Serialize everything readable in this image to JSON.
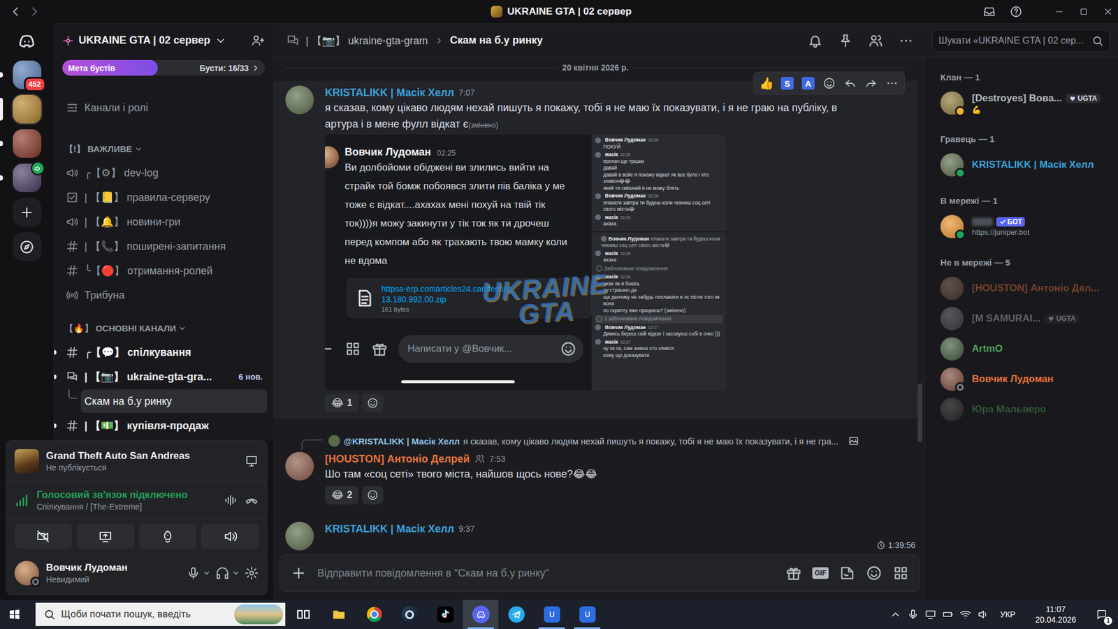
{
  "window": {
    "title": "UKRAINE GTA | 02 сервер"
  },
  "servers": [
    {
      "kind": "home",
      "selected": false,
      "unread": false
    },
    {
      "kind": "server",
      "color": "#5a7fb8",
      "badge": "452",
      "selected": false,
      "unread": true,
      "voice": false
    },
    {
      "kind": "server",
      "color": "#b8862e",
      "selected": true,
      "unread": false,
      "voice": false
    },
    {
      "kind": "server",
      "color": "#8b3a2a",
      "selected": false,
      "unread": true,
      "voice": false
    },
    {
      "kind": "server",
      "color": "#4b3d66",
      "selected": false,
      "unread": true,
      "voice": true
    },
    {
      "kind": "add",
      "selected": false,
      "unread": false
    },
    {
      "kind": "discover",
      "selected": false,
      "unread": false
    }
  ],
  "server": {
    "name": "UKRAINE GTA | 02 сервер",
    "boost_label": "Мета бустів",
    "boost_count": "Бусти: 16/33",
    "boost_level": 0.47
  },
  "channels": [
    {
      "kind": "link",
      "name": "Канали і ролі",
      "unread": false,
      "selected": false
    },
    {
      "kind": "category",
      "name": "【!】 ВАЖЛИВЕ",
      "expanded": true
    },
    {
      "kind": "announcement",
      "name": "╭【⚙】 dev-log",
      "unread": false,
      "selected": false
    },
    {
      "kind": "rules",
      "name": "| 【📒】 правила-серверу",
      "unread": false,
      "selected": false
    },
    {
      "kind": "announcement",
      "name": "| 【🔔】 новини-гри",
      "unread": false,
      "selected": false
    },
    {
      "kind": "text",
      "name": "| 【📞】 поширені-запитання",
      "unread": false,
      "selected": false
    },
    {
      "kind": "text",
      "name": "╰【🔴】 отримання-ролей",
      "unread": false,
      "selected": false
    },
    {
      "kind": "stage",
      "name": "Трибуна",
      "unread": false,
      "selected": false
    },
    {
      "kind": "category",
      "name": "【🔥】 ОСНОВНІ КАНАЛИ",
      "expanded": true
    },
    {
      "kind": "text",
      "name": "╭【💬】 спілкування",
      "unread": true,
      "selected": false
    },
    {
      "kind": "forum",
      "name": "| 【📷】 ukraine-gta-gra...",
      "unread": true,
      "selected": false,
      "badge": "6 нов."
    },
    {
      "kind": "thread",
      "name": "Скам на б.у ринку",
      "unread": false,
      "selected": true
    },
    {
      "kind": "text",
      "name": "| 【💵】 купівля-продаж",
      "unread": true,
      "selected": false
    }
  ],
  "activity": {
    "game": "Grand Theft Auto San Andreas",
    "status": "Не публікується"
  },
  "voice": {
    "status": "Голосовий зв'язок підключено",
    "channel": "Спілкування / [The-Extreme]",
    "camera_on": false
  },
  "user": {
    "name": "Вовчик Лудоман",
    "status": "Невидимий",
    "presence": "invisible"
  },
  "header": {
    "forum": "| 【📷】 ukraine-gta-gram",
    "thread": "Скам на б.у ринку",
    "search_placeholder": "Шукати «UKRAINE GTA | 02 сер..."
  },
  "date_divider": "20 квітня 2026 р.",
  "hover_toolbar": [
    {
      "kind": "emoji",
      "label": "👍"
    },
    {
      "kind": "app",
      "label": "S"
    },
    {
      "kind": "app",
      "label": "A"
    },
    {
      "kind": "add-reaction"
    },
    {
      "kind": "reply"
    },
    {
      "kind": "forward"
    },
    {
      "kind": "more"
    }
  ],
  "messages": [
    {
      "author": "KRISTALIKK | Масік Хелл",
      "color": "#3ba2dc",
      "avatar": "#5b6b4a",
      "role_icon": false,
      "time": "7:07",
      "hovered": true,
      "text": "я сказав, кому цікаво людям нехай пишуть я покажу, тобі я не маю їх показувати, і я не граю на публіку, в артура і в мене фулл відкат є",
      "edited": "(змінено)",
      "embed": {
        "author": "Вовчик Лудоман",
        "time": "02:25",
        "lines": [
          "Ви долбойоми обіджені ви злились вийти на",
          "страйк той бомж побоявся злити пів баліка у ме",
          "тоже є відкат....ахахах мені похуй на твій тік",
          "ток))))я можу закинути у тік ток як ти дрочеш",
          "перед компом або як трахають твою мамку коли",
          "не вдома"
        ],
        "file": {
          "name": [
            "httpsa-erp.comarticles24.camfecting",
            "13.180.992.00.zip"
          ],
          "size": "161 bytes"
        },
        "input_placeholder": "Написати у @Вовчик...",
        "watermark": [
          "UKRAINE",
          "GTA"
        ],
        "chat": [
          {
            "kind": "message",
            "author": "Вовчик Лудоман",
            "time": "02:25",
            "lines": [
              "ПОХУЙ"
            ]
          },
          {
            "kind": "message",
            "author": "масік",
            "time": "02:25",
            "lines": [
              "поплач ще трішки",
              "давай",
              "давай в войс я покажу відкат як все було і хто злився😂😂",
              "який ти смішний я не можу блять"
            ]
          },
          {
            "kind": "message",
            "author": "Вовчик Лудоман",
            "time": "02:26",
            "lines": [
              "плакати завтра ти будеш коли чекниш соц сеті свого міста😂"
            ]
          },
          {
            "kind": "message",
            "author": "масік",
            "time": "02:26",
            "lines": [
              "ахаха"
            ]
          },
          {
            "kind": "break"
          },
          {
            "kind": "reply",
            "author": "Вовчик Лудоман",
            "text": "плакати завтра ти будеш коли чекниш соц сеті свого міста😂"
          },
          {
            "kind": "message",
            "author": "масік",
            "time": "02:26",
            "lines": [
              "ахаха"
            ]
          },
          {
            "kind": "system",
            "text": "Заблоковане повідомлення",
            "highlighted": false
          },
          {
            "kind": "message",
            "author": "масік",
            "time": "02:26",
            "lines": [
              "ахах як я боюсь",
              "ну страшно да",
              "ще денчику не забудь поплакати в лс після того як вона",
              "по скрипту вже працюєш? (змінено)"
            ]
          },
          {
            "kind": "system",
            "text": "1 заблоковане повідомлення",
            "highlighted": true
          },
          {
            "kind": "message",
            "author": "Вовчик Лудоман",
            "time": "02:27",
            "lines": [
              "Дивись береш свій відкат і засовуєш собі в очко )))"
            ]
          },
          {
            "kind": "message",
            "author": "масік",
            "time": "02:27",
            "lines": [
              "ну ок ок, сам знаєш хто злився",
              "кому що доказувати"
            ]
          }
        ]
      },
      "reactions": [
        {
          "emoji": "😂",
          "count": "1",
          "selected": false
        }
      ]
    },
    {
      "author": "[HOUSTON] Антоніо Делрей",
      "color": "#e8743b",
      "avatar": "#8a5a4a",
      "role_icon": true,
      "time": "7:53",
      "hovered": false,
      "reply": {
        "author": "@KRISTALIKK | Масік Хелл",
        "text": "я сказав, кому цікаво людям нехай пишуть я покажу, тобі я не маю їх показувати, і я не гра...",
        "has_image": true
      },
      "text": "Шо там «соц сеті» твого міста, найшов щось нове?😂😂",
      "reactions": [
        {
          "emoji": "😂",
          "count": "2",
          "selected": false
        }
      ]
    },
    {
      "author": "KRISTALIKK | Масік Хелл",
      "color": "#3ba2dc",
      "avatar": "#5b6b4a",
      "role_icon": false,
      "time": "9:37",
      "hovered": false
    }
  ],
  "slowmode": "1:39:56",
  "composer": {
    "placeholder": "Відправити повідомлення в \"Скам на б.у ринку\"",
    "gif": "GIF"
  },
  "scroll": {
    "offset": 0.66,
    "size": 0.12
  },
  "member_groups": [
    {
      "title": "Клан — 1",
      "members": [
        {
          "name": "[Destroyes] Вова...",
          "color": "#b5bac1",
          "avatar": "#8a7a3a",
          "status": "idle",
          "badge": "UGTA",
          "activity": "💪",
          "dimmed": false
        }
      ]
    },
    {
      "title": "Гравець — 1",
      "members": [
        {
          "name": "KRISTALIKK | Масік Хелл",
          "color": "#3ba2dc",
          "avatar": "#5b6b4a",
          "status": "online",
          "dimmed": false
        }
      ]
    },
    {
      "title": "В мережі — 1",
      "members": [
        {
          "redacted": true,
          "bot_label": "БОТ",
          "activity": "https://juniper.bot",
          "avatar": "#e8912e",
          "status": "online",
          "dimmed": false
        }
      ]
    },
    {
      "title": "Не в мережі — 5",
      "members": [
        {
          "name": "[HOUSTON] Антоніо Дел...",
          "color": "#e8743b",
          "avatar": "#8a5a4a",
          "status": "offline",
          "dimmed": true
        },
        {
          "name": "[M SAMURAI...",
          "color": "#b5bac1",
          "avatar": "#6a6a72",
          "status": "offline",
          "badge": "UGTA",
          "dimmed": true
        },
        {
          "name": "ArtmO",
          "color": "#4fa35a",
          "avatar": "#3e5a3e",
          "status": "offline",
          "dimmed": false
        },
        {
          "name": "Вовчик Лудоман",
          "color": "#e8743b",
          "avatar": "#7a4a3a",
          "status": "invisible",
          "dimmed": false
        },
        {
          "name": "Юра Мальверо",
          "color": "#4fa35a",
          "avatar": "#3a3a3a",
          "status": "offline",
          "dimmed": true
        }
      ]
    }
  ],
  "taskbar": {
    "search_placeholder": "Щоби почати пошук, введіть",
    "apps": [
      {
        "kind": "taskview",
        "active": false,
        "running": false
      },
      {
        "kind": "explorer",
        "active": false,
        "running": false
      },
      {
        "kind": "chrome",
        "active": false,
        "running": false
      },
      {
        "kind": "steam",
        "active": false,
        "running": false
      },
      {
        "kind": "tiktok",
        "active": false,
        "running": false
      },
      {
        "kind": "discord",
        "active": true,
        "running": true
      },
      {
        "kind": "telegram",
        "active": false,
        "running": false
      },
      {
        "kind": "app-u",
        "active": false,
        "running": true
      },
      {
        "kind": "app-u",
        "active": false,
        "running": true
      }
    ],
    "language": "УКР",
    "time": "11:07",
    "date": "20.04.2026",
    "notifications": "1"
  }
}
